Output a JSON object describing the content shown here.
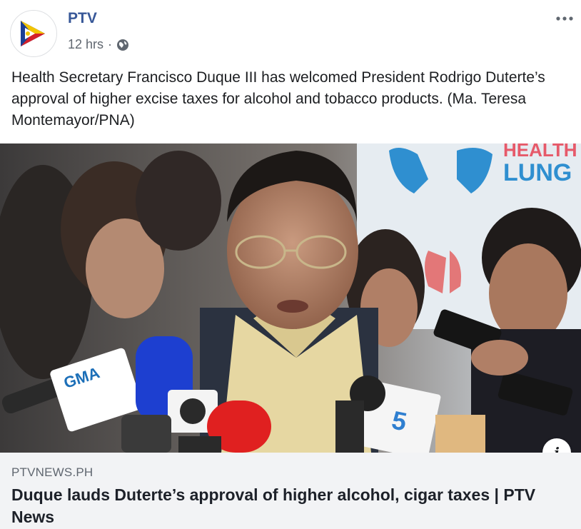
{
  "post": {
    "page_name": "PTV",
    "timestamp": "12 hrs",
    "separator": "·",
    "audience_icon": "globe-icon",
    "more_icon": "more-horizontal-icon",
    "caption": "Health Secretary Francisco Duque III has welcomed President Rodrigo Duterte’s approval of higher excise taxes for alcohol and tobacco products. (Ma. Teresa Montemayor/PNA)"
  },
  "photo": {
    "mic_labels": [
      "GMA",
      "5"
    ],
    "backdrop_text": [
      "HEALTH",
      "LUNG"
    ]
  },
  "link_preview": {
    "domain": "PTVNEWS.PH",
    "title": "Duque lauds Duterte’s approval of higher alcohol, cigar taxes | PTV News",
    "info_label": "i"
  },
  "colors": {
    "page_name": "#385898",
    "meta_text": "#606770",
    "link_bg": "#f2f3f5",
    "backdrop_blue": "#2f8fd0"
  }
}
